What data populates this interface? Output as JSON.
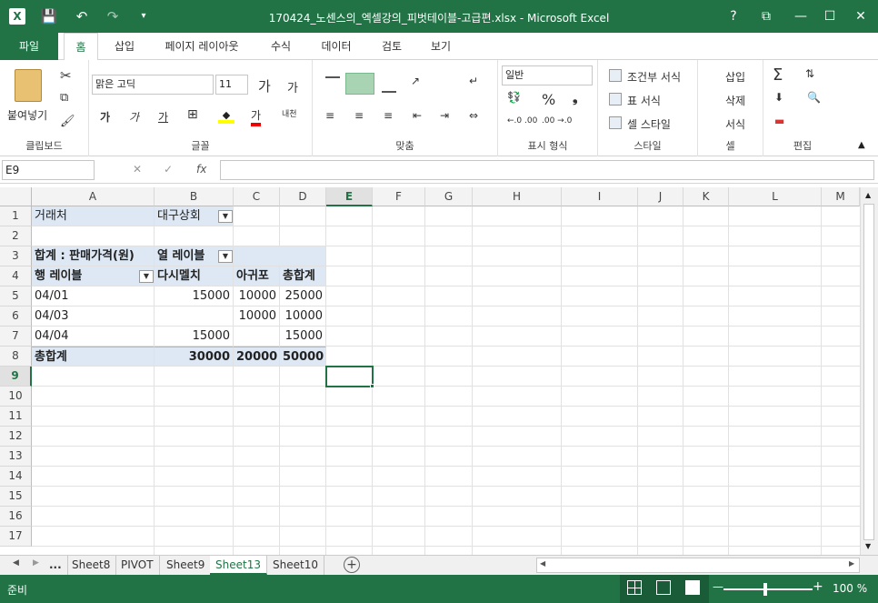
{
  "window": {
    "title": "170424_노센스의_엑셀강의_피벗테이블-고급편.xlsx - Microsoft Excel",
    "help": "?",
    "restore": "⧉",
    "minimize": "—",
    "maximize": "☐",
    "close": "✕"
  },
  "tabs": [
    "파일",
    "홈",
    "삽입",
    "페이지 레이아웃",
    "수식",
    "데이터",
    "검토",
    "보기"
  ],
  "ribbon": {
    "clipboard": {
      "label": "클립보드",
      "paste": "붙여넣기"
    },
    "font": {
      "label": "글꼴",
      "name": "맑은 고딕",
      "size": "11",
      "inc": "가",
      "dec": "가",
      "bold": "가",
      "italic": "가",
      "underline": "가",
      "color": "가",
      "phonetic": "내천"
    },
    "align": {
      "label": "맞춤"
    },
    "number": {
      "label": "표시 형식",
      "format": "일반",
      "pct": "%",
      "comma": "❟",
      "incdec": "←.0 .00",
      "decdec": ".00 →.0"
    },
    "styles": {
      "label": "스타일",
      "cond": "조건부 서식",
      "table": "표 서식",
      "cell": "셀 스타일"
    },
    "cells": {
      "label": "셀",
      "insert": "삽입",
      "delete": "삭제",
      "format": "서식"
    },
    "editing": {
      "label": "편집"
    }
  },
  "formula_bar": {
    "name_box": "E9",
    "cancel": "✕",
    "enter": "✓",
    "fx": "fx",
    "content": ""
  },
  "columns": [
    "A",
    "B",
    "C",
    "D",
    "E",
    "F",
    "G",
    "H",
    "I",
    "J",
    "K",
    "L",
    "M"
  ],
  "rows": [
    "1",
    "2",
    "3",
    "4",
    "5",
    "6",
    "7",
    "8",
    "9",
    "10",
    "11",
    "12",
    "13",
    "14",
    "15",
    "16",
    "17"
  ],
  "pivot": {
    "filter_label": "거래처",
    "filter_value": "대구상회",
    "data_label": "합계 : 판매가격(원)",
    "col_labels": "열 레이블",
    "row_labels": "행 레이블",
    "col1": "다시멜치",
    "col2": "아귀포",
    "col3": "총합계",
    "data": [
      {
        "row": "04/01",
        "b": "15000",
        "c": "10000",
        "d": "25000"
      },
      {
        "row": "04/03",
        "b": "",
        "c": "10000",
        "d": "10000"
      },
      {
        "row": "04/04",
        "b": "15000",
        "c": "",
        "d": "15000"
      }
    ],
    "total": {
      "row": "총합계",
      "b": "30000",
      "c": "20000",
      "d": "50000"
    }
  },
  "sheets": [
    "...",
    "Sheet8",
    "PIVOT",
    "Sheet9",
    "Sheet13",
    "Sheet10"
  ],
  "active_sheet": "Sheet13",
  "status": {
    "ready": "준비",
    "zoom": "100 %",
    "minus": "—",
    "plus": "+"
  }
}
